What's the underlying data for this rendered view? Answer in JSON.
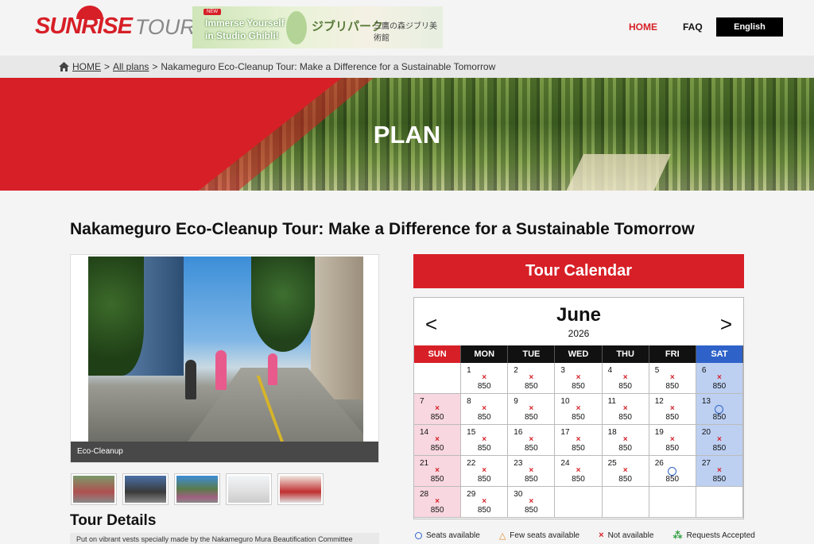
{
  "brand": {
    "name_red": "SUNRISE",
    "name_gray": "TOURS"
  },
  "banner": {
    "tag": "NEW",
    "line1": "Immerse Yourself",
    "line2": "in Studio Ghibli!",
    "jp_title": "ジブリパーク",
    "jp_museum": "三鷹の森ジブリ美術館"
  },
  "nav": {
    "home": "HOME",
    "faq": "FAQ",
    "language": "English"
  },
  "breadcrumb": {
    "home": "HOME",
    "all_plans": "All plans",
    "current": "Nakameguro Eco-Cleanup Tour: Make a Difference for a Sustainable Tomorrow",
    "sep": ">"
  },
  "hero": {
    "title": "PLAN"
  },
  "tour": {
    "title": "Nakameguro Eco-Cleanup Tour: Make a Difference for a Sustainable Tomorrow",
    "photo_caption": "Eco-Cleanup",
    "details_title": "Tour Details",
    "details_text": "Put on vibrant vests specially made by the Nakameguro Mura Beautification Committee"
  },
  "calendar": {
    "header": "Tour Calendar",
    "month": "June",
    "year": "2026",
    "prev": "<",
    "next": ">",
    "weekdays": [
      "SUN",
      "MON",
      "TUE",
      "WED",
      "THU",
      "FRI",
      "SAT"
    ],
    "weeks": [
      [
        null,
        {
          "day": "1",
          "mark": "x",
          "price": "850"
        },
        {
          "day": "2",
          "mark": "x",
          "price": "850"
        },
        {
          "day": "3",
          "mark": "x",
          "price": "850"
        },
        {
          "day": "4",
          "mark": "x",
          "price": "850"
        },
        {
          "day": "5",
          "mark": "x",
          "price": "850"
        },
        {
          "day": "6",
          "mark": "x",
          "price": "850"
        }
      ],
      [
        {
          "day": "7",
          "mark": "x",
          "price": "850"
        },
        {
          "day": "8",
          "mark": "x",
          "price": "850"
        },
        {
          "day": "9",
          "mark": "x",
          "price": "850"
        },
        {
          "day": "10",
          "mark": "x",
          "price": "850"
        },
        {
          "day": "11",
          "mark": "x",
          "price": "850"
        },
        {
          "day": "12",
          "mark": "x",
          "price": "850"
        },
        {
          "day": "13",
          "mark": "o",
          "price": "850"
        }
      ],
      [
        {
          "day": "14",
          "mark": "x",
          "price": "850"
        },
        {
          "day": "15",
          "mark": "x",
          "price": "850"
        },
        {
          "day": "16",
          "mark": "x",
          "price": "850"
        },
        {
          "day": "17",
          "mark": "x",
          "price": "850"
        },
        {
          "day": "18",
          "mark": "x",
          "price": "850"
        },
        {
          "day": "19",
          "mark": "x",
          "price": "850"
        },
        {
          "day": "20",
          "mark": "x",
          "price": "850"
        }
      ],
      [
        {
          "day": "21",
          "mark": "x",
          "price": "850"
        },
        {
          "day": "22",
          "mark": "x",
          "price": "850"
        },
        {
          "day": "23",
          "mark": "x",
          "price": "850"
        },
        {
          "day": "24",
          "mark": "x",
          "price": "850"
        },
        {
          "day": "25",
          "mark": "x",
          "price": "850"
        },
        {
          "day": "26",
          "mark": "o",
          "price": "850"
        },
        {
          "day": "27",
          "mark": "x",
          "price": "850"
        }
      ],
      [
        {
          "day": "28",
          "mark": "x",
          "price": "850"
        },
        {
          "day": "29",
          "mark": "x",
          "price": "850"
        },
        {
          "day": "30",
          "mark": "x",
          "price": "850"
        },
        null,
        null,
        null,
        null
      ]
    ],
    "legend": {
      "available": "Seats available",
      "few": "Few seats available",
      "not_available": "Not available",
      "requests": "Requests Accepted"
    }
  },
  "colors": {
    "brand_red": "#d71f27",
    "saturday_blue": "#2f62c9",
    "sunday_pink": "#f8d7e0",
    "saturday_light": "#bdd0f2"
  }
}
